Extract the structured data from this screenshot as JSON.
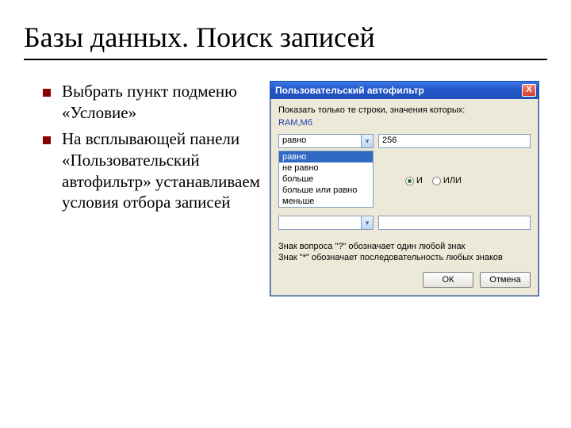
{
  "title": "Базы данных. Поиск записей",
  "bullets": [
    "Выбрать пункт подменю «Условие»",
    "На всплывающей панели «Пользовательский автофильтр» устанавливаем условия отбора записей"
  ],
  "dialog": {
    "title": "Пользовательский автофильтр",
    "close_x": "X",
    "show_label": "Показать только те строки, значения которых:",
    "field_label": "RAM,Мб",
    "cond1": {
      "op": "равно",
      "value": "256"
    },
    "options": [
      "равно",
      "не равно",
      "больше",
      "больше или равно",
      "меньше"
    ],
    "radio": {
      "and": "И",
      "or": "ИЛИ",
      "selected": "and"
    },
    "cond2": {
      "op": "",
      "value": ""
    },
    "hint1": "Знак вопроса \"?\" обозначает один любой знак",
    "hint2": "Знак \"*\" обозначает последовательность любых знаков",
    "ok": "ОК",
    "cancel": "Отмена"
  }
}
